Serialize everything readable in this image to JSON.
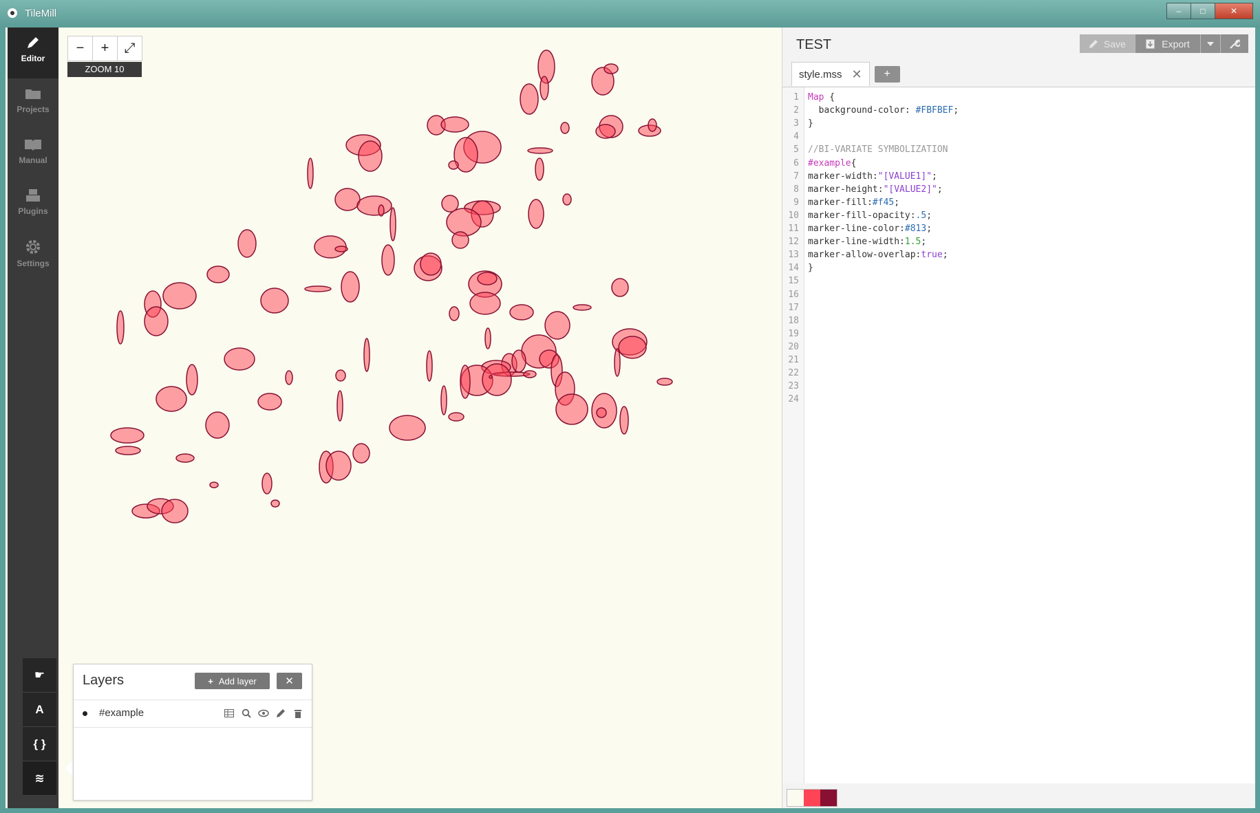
{
  "window": {
    "title": "TileMill",
    "minimize": "–",
    "maximize": "□",
    "close": "✕"
  },
  "sidebar": {
    "items": [
      {
        "label": "Editor",
        "icon": "pencil-icon",
        "active": true
      },
      {
        "label": "Projects",
        "icon": "folder-icon",
        "active": false
      },
      {
        "label": "Manual",
        "icon": "book-icon",
        "active": false
      },
      {
        "label": "Plugins",
        "icon": "plug-icon",
        "active": false
      },
      {
        "label": "Settings",
        "icon": "gear-icon",
        "active": false
      }
    ],
    "tools": [
      {
        "name": "hand-tool",
        "glyph": "☛"
      },
      {
        "name": "fonts-tool",
        "glyph": "A"
      },
      {
        "name": "carto-tool",
        "glyph": "{ }"
      },
      {
        "name": "layers-tool",
        "glyph": "≋"
      }
    ]
  },
  "map": {
    "zoom_out": "−",
    "zoom_in": "+",
    "fullscreen": "⤢",
    "zoom_label": "ZOOM 10",
    "background": "#FBFBEF",
    "marker_fill": "#f45",
    "marker_line": "#813"
  },
  "layers": {
    "title": "Layers",
    "add_layer": "Add layer",
    "close": "✕",
    "items": [
      {
        "name": "#example"
      }
    ]
  },
  "editor": {
    "project_title": "TEST",
    "save_label": "Save",
    "export_label": "Export",
    "tabs": [
      {
        "label": "style.mss",
        "close": "✕"
      }
    ],
    "add_tab": "+",
    "line_numbers": [
      "1",
      "2",
      "3",
      "4",
      "5",
      "6",
      "7",
      "8",
      "9",
      "10",
      "11",
      "12",
      "13",
      "14",
      "15",
      "16",
      "17",
      "18",
      "19",
      "20",
      "21",
      "22",
      "23",
      "24"
    ],
    "code": [
      [
        {
          "t": "Map",
          "c": "c-sel"
        },
        {
          "t": " {",
          "c": "c-prop"
        }
      ],
      [
        {
          "t": "  background-color: ",
          "c": "c-prop"
        },
        {
          "t": "#FBFBEF",
          "c": "c-val"
        },
        {
          "t": ";",
          "c": "c-prop"
        }
      ],
      [
        {
          "t": "}",
          "c": "c-prop"
        }
      ],
      [],
      [
        {
          "t": "//BI-VARIATE SYMBOLIZATION",
          "c": "c-com"
        }
      ],
      [
        {
          "t": "#example",
          "c": "c-sel"
        },
        {
          "t": "{",
          "c": "c-prop"
        }
      ],
      [
        {
          "t": "marker-width:",
          "c": "c-prop"
        },
        {
          "t": "\"[VALUE1]\"",
          "c": "c-str"
        },
        {
          "t": ";",
          "c": "c-prop"
        }
      ],
      [
        {
          "t": "marker-height:",
          "c": "c-prop"
        },
        {
          "t": "\"[VALUE2]\"",
          "c": "c-str"
        },
        {
          "t": ";",
          "c": "c-prop"
        }
      ],
      [
        {
          "t": "marker-fill:",
          "c": "c-prop"
        },
        {
          "t": "#f45",
          "c": "c-val"
        },
        {
          "t": ";",
          "c": "c-prop"
        }
      ],
      [
        {
          "t": "marker-fill-opacity:",
          "c": "c-prop"
        },
        {
          "t": ".5",
          "c": "c-val"
        },
        {
          "t": ";",
          "c": "c-prop"
        }
      ],
      [
        {
          "t": "marker-line-color:",
          "c": "c-prop"
        },
        {
          "t": "#813",
          "c": "c-val"
        },
        {
          "t": ";",
          "c": "c-prop"
        }
      ],
      [
        {
          "t": "marker-line-width:",
          "c": "c-prop"
        },
        {
          "t": "1.5",
          "c": "c-num"
        },
        {
          "t": ";",
          "c": "c-prop"
        }
      ],
      [
        {
          "t": "marker-allow-overlap:",
          "c": "c-prop"
        },
        {
          "t": "true",
          "c": "c-kw"
        },
        {
          "t": ";",
          "c": "c-prop"
        }
      ],
      [
        {
          "t": "}",
          "c": "c-prop"
        }
      ],
      [],
      [],
      [],
      [],
      [],
      [],
      [],
      [],
      [],
      []
    ],
    "swatches": [
      "#FBFBEF",
      "#f45",
      "#813"
    ]
  }
}
